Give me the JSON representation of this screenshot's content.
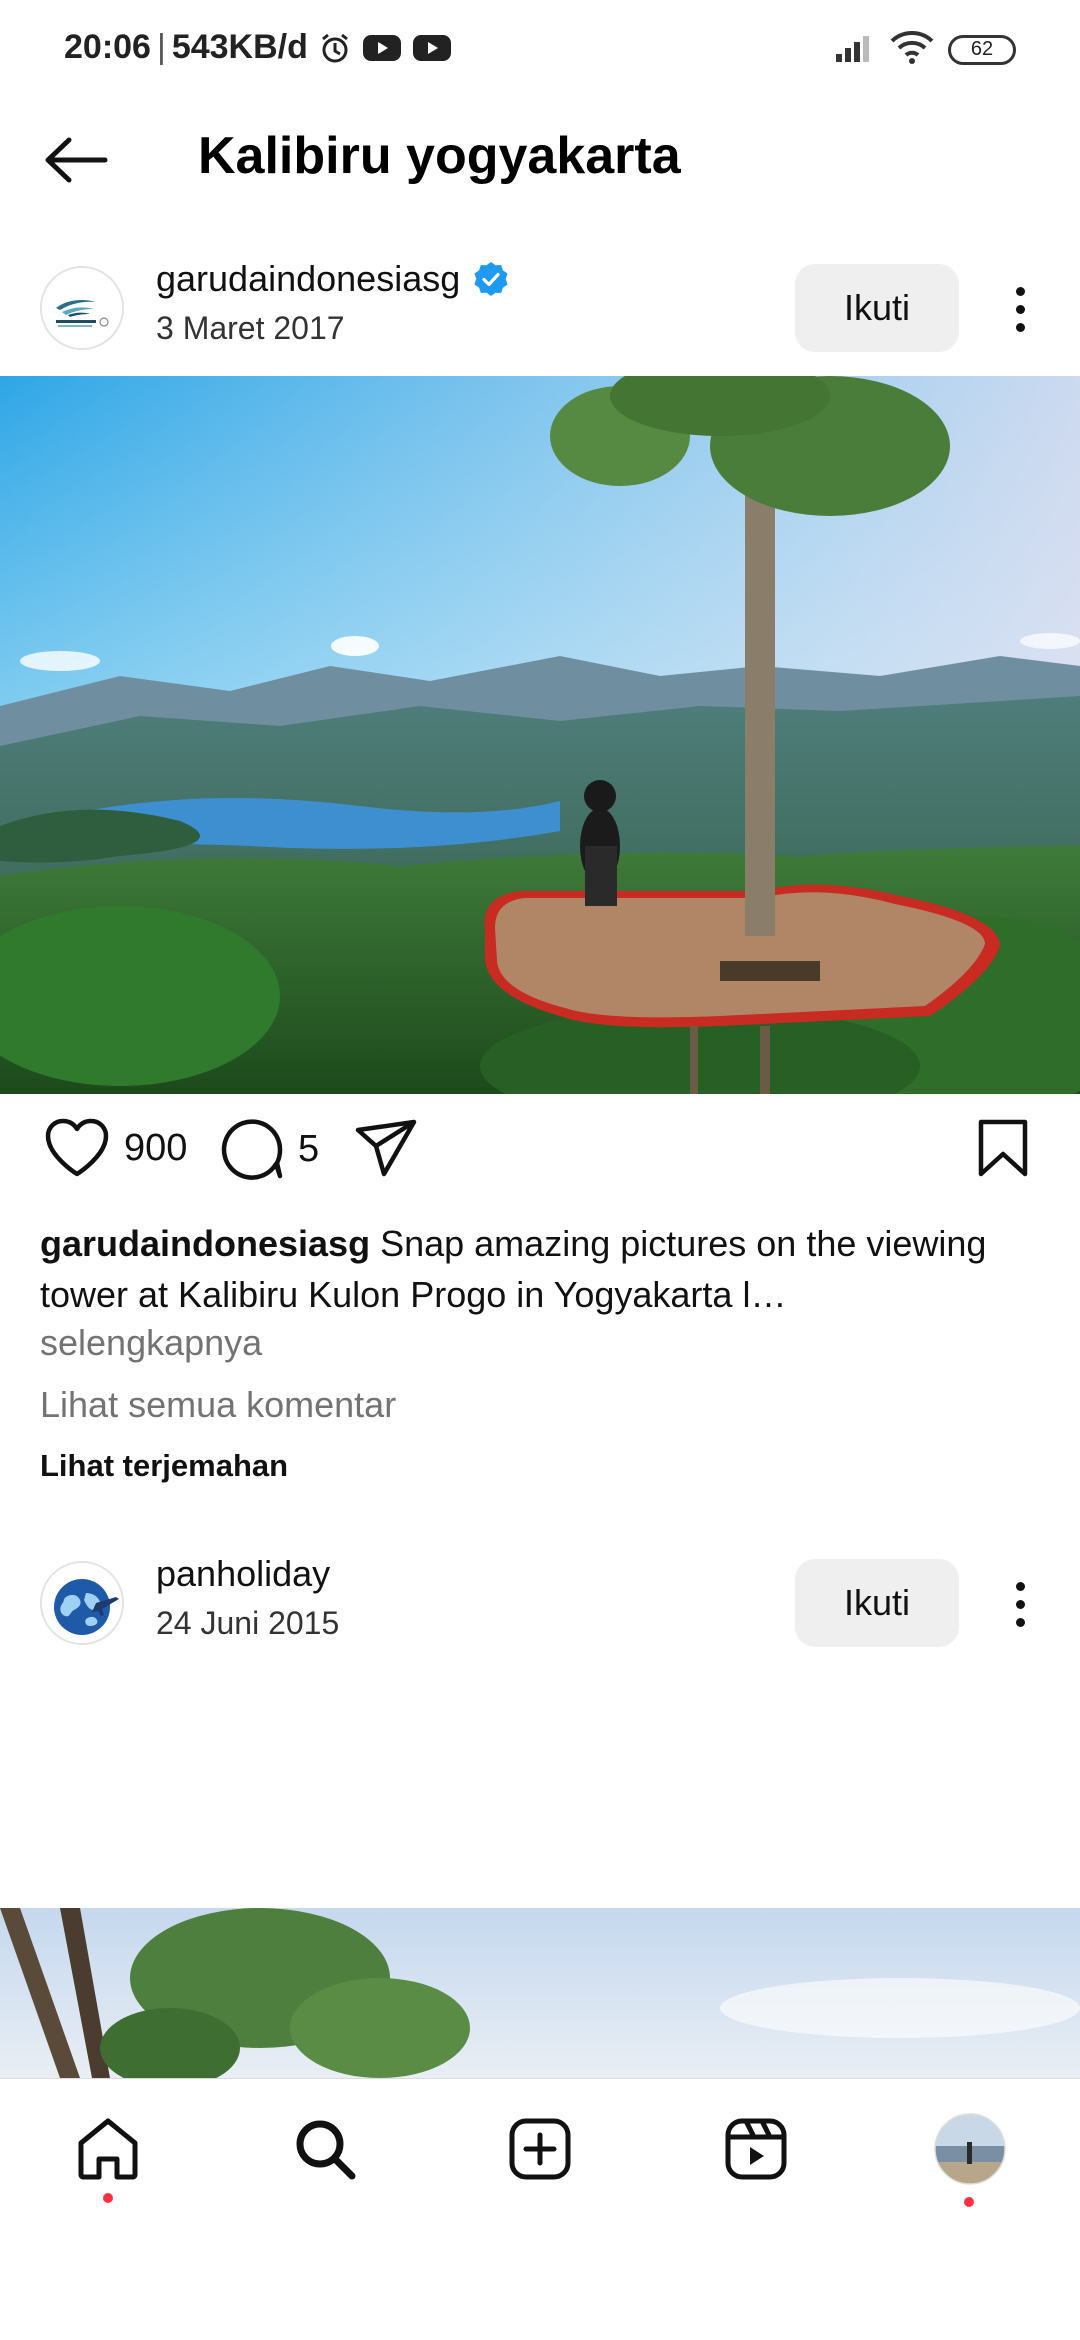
{
  "status_bar": {
    "time": "20:06",
    "separator": "|",
    "speed": "543KB/d",
    "battery": "62",
    "icons": [
      "alarm-icon",
      "youtube-icon",
      "youtube-icon",
      "signal-icon",
      "wifi-icon",
      "battery-icon"
    ]
  },
  "header": {
    "title": "Kalibiru yogyakarta",
    "back_icon": "arrow-left-icon"
  },
  "posts": [
    {
      "username": "garudaindonesiasg",
      "verified": true,
      "date": "3 Maret 2017",
      "follow_label": "Ikuti",
      "likes": "900",
      "comments": "5",
      "caption_user": "garudaindonesiasg",
      "caption_text": " Snap amazing pictures on the viewing tower at Kalibiru Kulon Progo in Yogyakarta l…",
      "more_label": "selengkapnya",
      "view_comments_label": "Lihat semua komentar",
      "translate_label": "Lihat terjemahan"
    },
    {
      "username": "panholiday",
      "verified": false,
      "date": "24 Juni 2015",
      "follow_label": "Ikuti"
    }
  ],
  "bottom_nav": {
    "items": [
      "home-icon",
      "search-icon",
      "create-icon",
      "reels-icon",
      "profile-avatar"
    ]
  },
  "colors": {
    "verified": "#1d9bf0",
    "notification_dot": "#ff3040",
    "follow_button_bg": "#efefef",
    "secondary_text": "#737373"
  }
}
